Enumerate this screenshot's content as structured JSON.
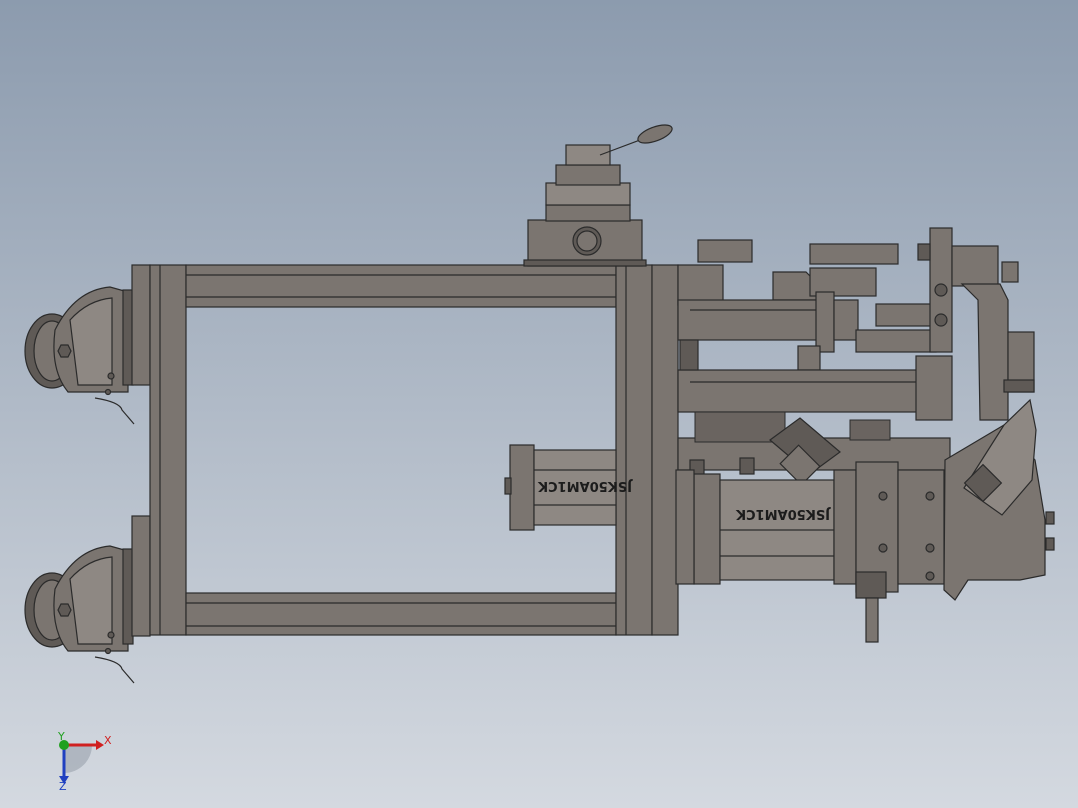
{
  "model": {
    "cylinder_label_upper": "JSK50AM1CK",
    "cylinder_label_lower": "JSK50AM1CK"
  },
  "triad": {
    "x_label": "X",
    "y_label": "Y",
    "z_label": "Z",
    "x_color": "#d02020",
    "y_color": "#20a020",
    "z_color": "#2040c0"
  },
  "colors": {
    "background_top": "#8c9bae",
    "background_bottom": "#d4d9e0",
    "metal": "#7b7570",
    "edge": "#2b2b2b"
  }
}
